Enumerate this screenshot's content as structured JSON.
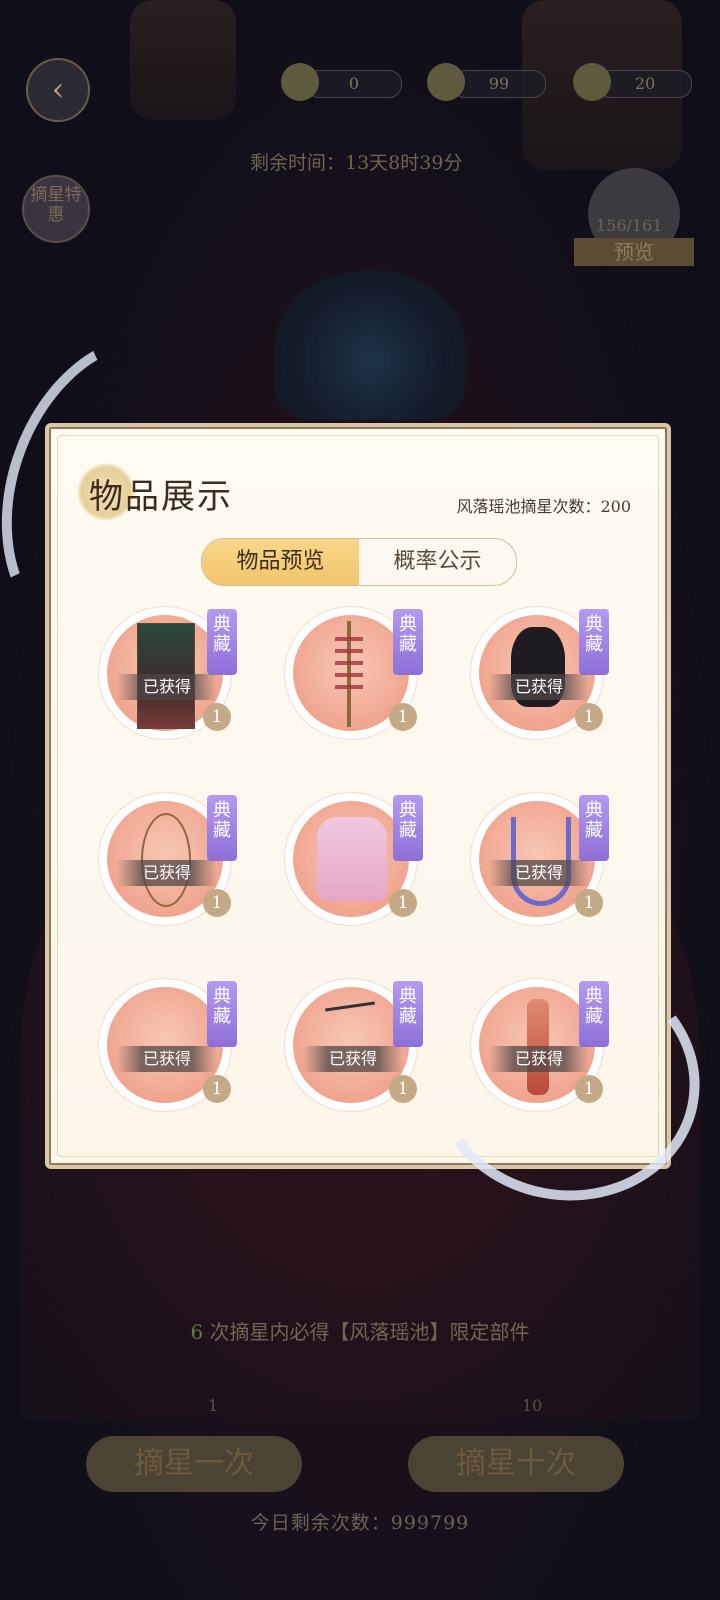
{
  "top_bar": {
    "back_icon": "back-arrow-icon",
    "resources": [
      {
        "name": "book-icon",
        "value": "0"
      },
      {
        "name": "coin-icon",
        "value": "99"
      },
      {
        "name": "pearl-icon",
        "value": "20"
      }
    ],
    "timer_text": "剩余时间：13天8时39分",
    "star_deal_label": "摘星特惠",
    "preview_count": "156/161",
    "preview_label": "预览"
  },
  "panel": {
    "title": "物品展示",
    "pull_count_text": "风落瑶池摘星次数：200",
    "tabs": [
      {
        "label": "物品预览",
        "active": true
      },
      {
        "label": "概率公示",
        "active": false
      }
    ],
    "tag_label": "典藏",
    "obtained_label": "已获得",
    "items": [
      {
        "name": "portrait-card",
        "qty": "1"
      },
      {
        "name": "hairpin-ornament",
        "qty": "1"
      },
      {
        "name": "hairstyle",
        "qty": "1"
      },
      {
        "name": "necklace",
        "qty": "1"
      },
      {
        "name": "pink-top-garment",
        "qty": "1"
      },
      {
        "name": "blue-sash",
        "qty": "1"
      },
      {
        "name": "item-7",
        "qty": "1"
      },
      {
        "name": "hair-stick",
        "qty": "1"
      },
      {
        "name": "figure-with-staff",
        "qty": "1"
      }
    ]
  },
  "bottom": {
    "guarantee_num": "6",
    "guarantee_text": "次摘星内必得【风落瑶池】限定部件",
    "draw_once_label": "摘星一次",
    "draw_once_cost": "1",
    "draw_ten_label": "摘星十次",
    "draw_ten_cost": "10",
    "remain_text": "今日剩余次数：999799"
  },
  "colors": {
    "panel_bg": "#fdf8ef",
    "tab_active": "#f1c56a",
    "tag_purple": "#9b7fe0",
    "circle_pink": "#f0a58f"
  }
}
